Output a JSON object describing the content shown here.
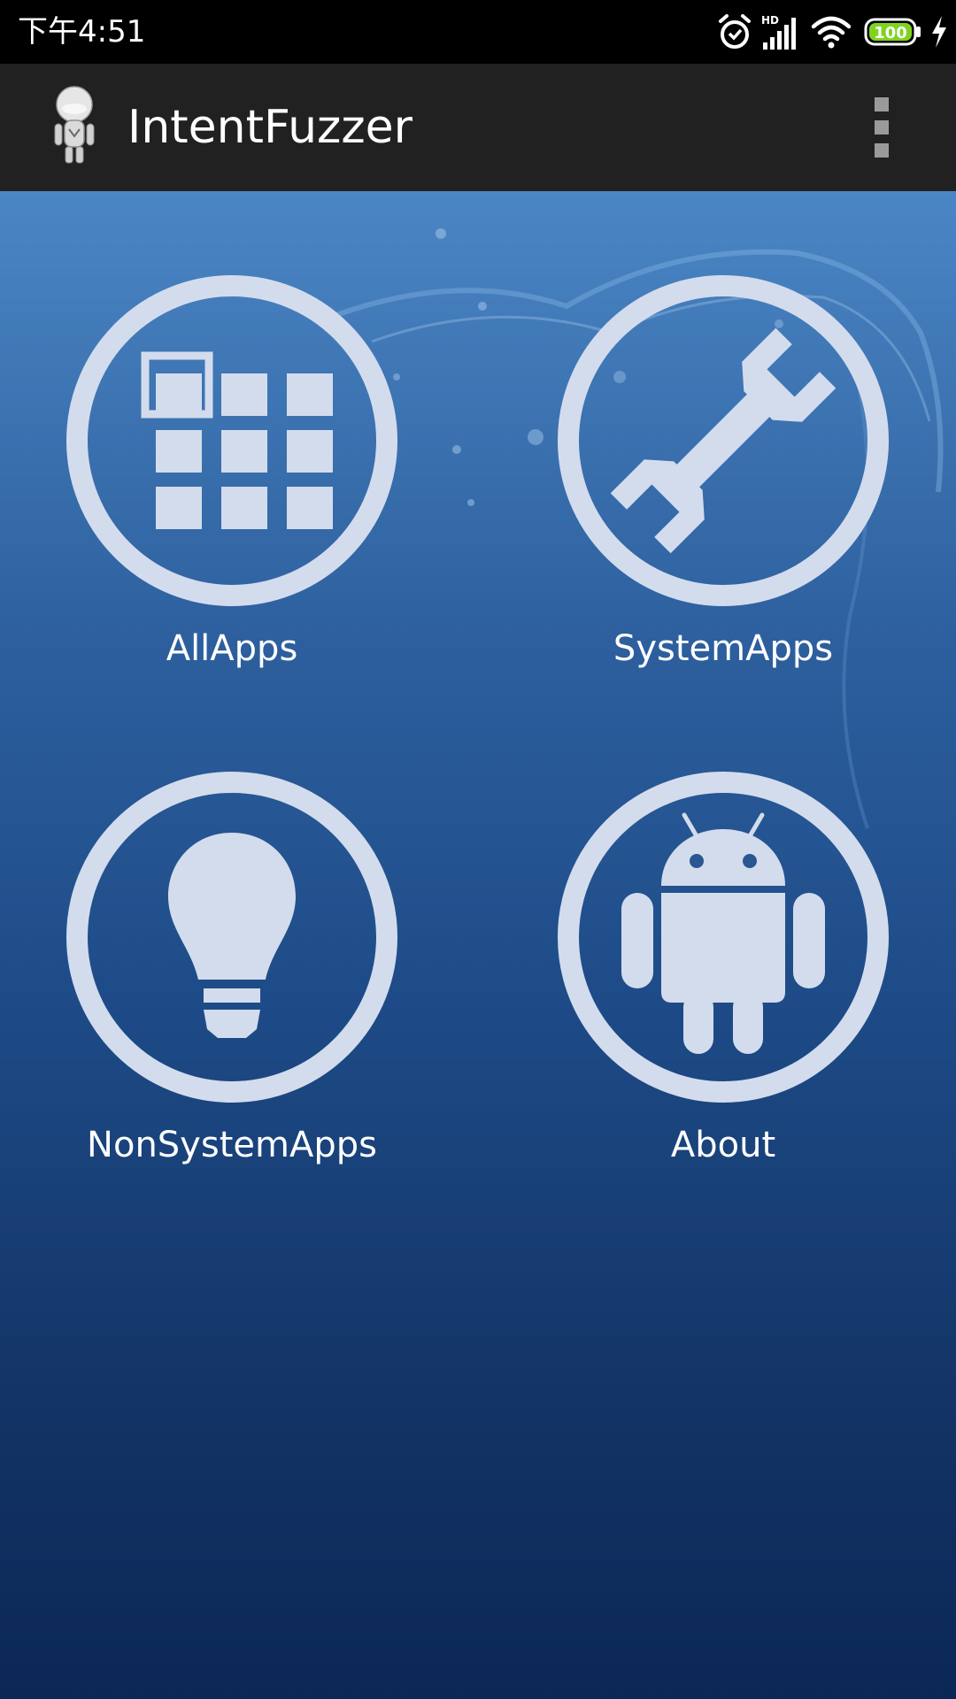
{
  "status_bar": {
    "time": "下午4:51",
    "network_badge": "HD",
    "battery_level": "100",
    "icons": [
      "alarm-icon",
      "signal-icon",
      "wifi-icon",
      "battery-icon",
      "charging-icon"
    ],
    "battery_color": "#7ed321"
  },
  "app_bar": {
    "title": "IntentFuzzer",
    "logo_icon": "robot-logo-icon",
    "menu_icon": "overflow-menu-icon"
  },
  "tiles": [
    {
      "label": "AllApps",
      "icon": "app-grid-icon"
    },
    {
      "label": "SystemApps",
      "icon": "wrench-icon"
    },
    {
      "label": "NonSystemApps",
      "icon": "lightbulb-icon"
    },
    {
      "label": "About",
      "icon": "android-icon"
    }
  ],
  "colors": {
    "status_bar": "#000000",
    "app_bar": "#212121",
    "background_top": "#4b86c4",
    "background_bottom": "#0b2756",
    "icon_tint": "#d3dced"
  }
}
